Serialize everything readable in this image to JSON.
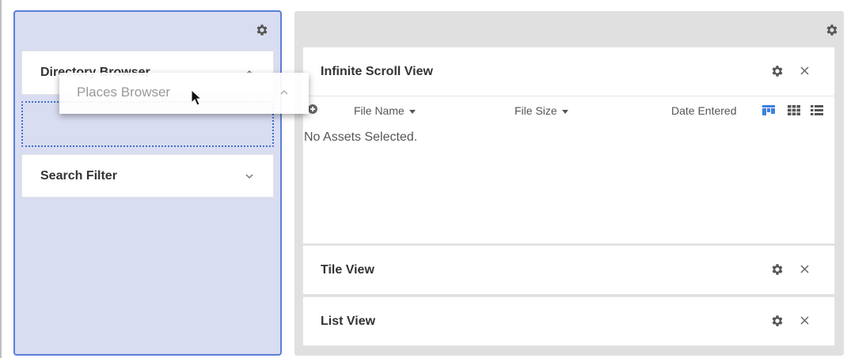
{
  "left_panel": {
    "panels": [
      {
        "title": "Directory Browser",
        "state": "expanded"
      },
      {
        "title": "Search Filter",
        "state": "collapsed"
      }
    ],
    "dragging": {
      "title": "Places Browser"
    }
  },
  "right_panel": {
    "views": [
      {
        "title": "Infinite Scroll View",
        "columns": [
          {
            "label": "File Name"
          },
          {
            "label": "File Size"
          },
          {
            "label": "Date Entered"
          }
        ],
        "empty_message": "No Assets Selected.",
        "display_modes": [
          "masonry",
          "grid",
          "list"
        ],
        "active_mode": "masonry"
      },
      {
        "title": "Tile View"
      },
      {
        "title": "List View"
      }
    ]
  },
  "colors": {
    "left_panel_bg": "#d9ddf1",
    "left_panel_border": "#5b7fd6",
    "accent": "#3f7fe0",
    "right_panel_bg": "#e0e0e0"
  },
  "icons": [
    "gear-icon",
    "chevron-up-icon",
    "chevron-down-icon",
    "close-icon",
    "add-column-icon",
    "masonry-view-icon",
    "grid-view-icon",
    "list-view-icon",
    "mouse-cursor-icon"
  ]
}
